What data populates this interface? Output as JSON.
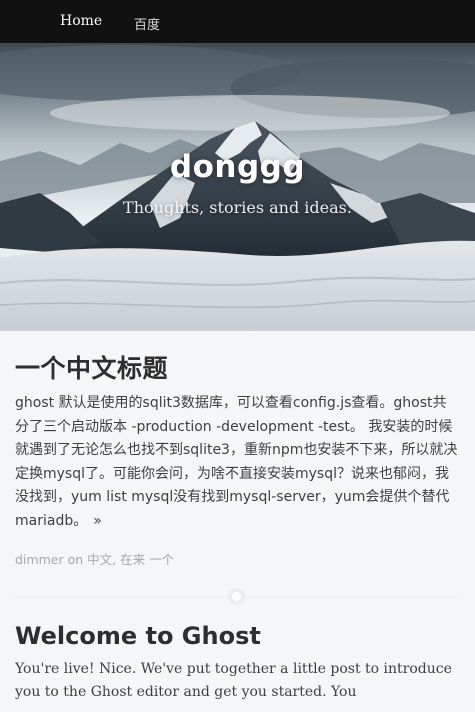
{
  "nav": {
    "items": [
      {
        "label": "Home"
      },
      {
        "label": "百度"
      }
    ]
  },
  "header": {
    "title": "donggg",
    "description": "Thoughts, stories and ideas."
  },
  "posts": [
    {
      "title": "一个中文标题",
      "excerpt": "ghost 默认是使用的sqlit3数据库，可以查看config.js查看。ghost共分了三个启动版本 -production -development -test。 我安装的时候就遇到了无论怎么也找不到sqlite3，重新npm也安装不下来，所以就决定换mysql了。可能你会问，为啥不直接安装mysql？说来也郁闷，我没找到，yum list mysql没有找到mysql-server，yum会提供个替代mariadb。",
      "more": "»",
      "author": "dimmer",
      "on": "on",
      "tags": "中文, 在来 一个"
    },
    {
      "title": "Welcome to Ghost",
      "excerpt": "You're live! Nice. We've put together a little post to introduce you to the Ghost editor and get you started. You"
    }
  ],
  "colors": {
    "nav_bg": "#111111",
    "page_bg": "#f5f6f7",
    "meta": "#9eabb3",
    "text": "#3a4145"
  }
}
